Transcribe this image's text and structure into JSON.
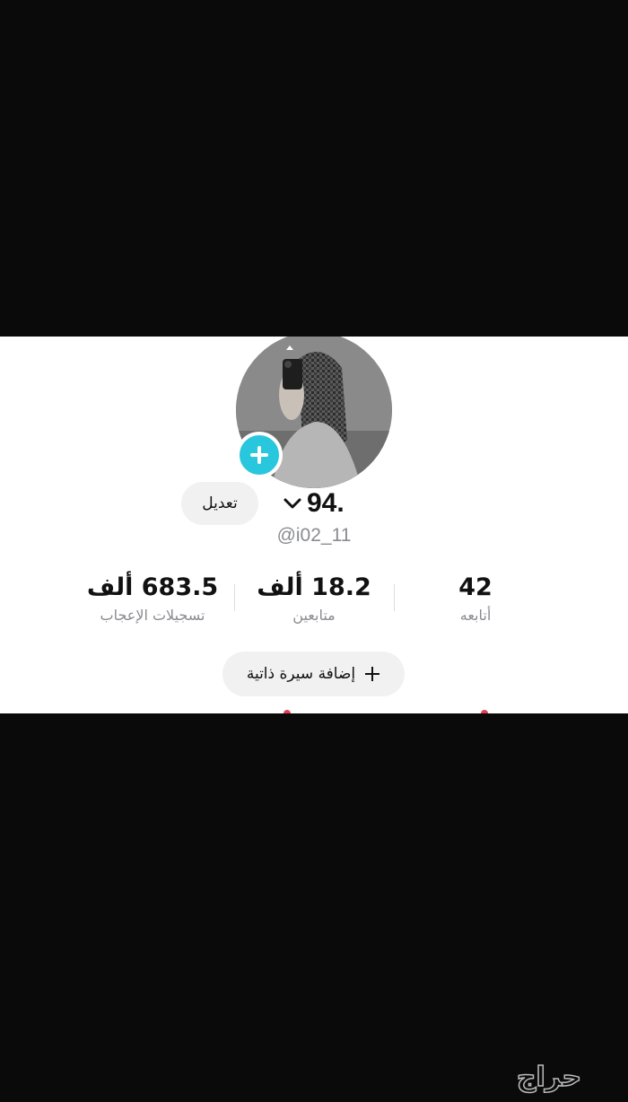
{
  "profile": {
    "name": "94.",
    "username": "@i02_11",
    "edit_label": "تعديل",
    "add_bio_label": "إضافة سيرة ذاتية",
    "add_bio_icon": "plus-icon",
    "avatar_icon": "person-photo",
    "add_photo_icon": "plus-icon",
    "accent_color": "#28c7dd"
  },
  "stats": {
    "following": {
      "value": "42",
      "label": "أتابعه"
    },
    "followers": {
      "value": "18.2 ألف",
      "label": "متابعين"
    },
    "likes": {
      "value": "683.5 ألف",
      "label": "تسجيلات الإعجاب"
    }
  },
  "watermark": {
    "text": "حراج"
  }
}
